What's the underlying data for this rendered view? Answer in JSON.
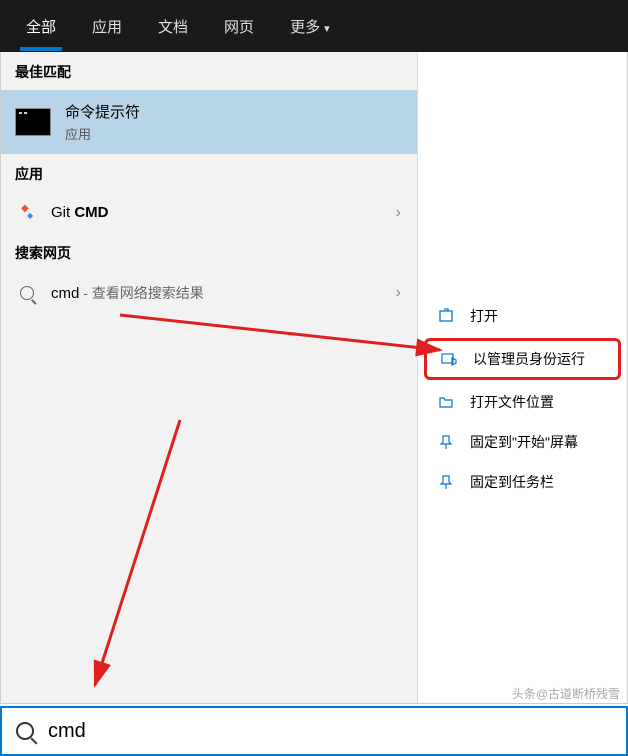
{
  "tabs": {
    "all": "全部",
    "apps": "应用",
    "docs": "文档",
    "web": "网页",
    "more": "更多"
  },
  "sections": {
    "best_match": "最佳匹配",
    "apps": "应用",
    "search_web": "搜索网页"
  },
  "best_match_item": {
    "title": "命令提示符",
    "subtitle": "应用"
  },
  "app_item": {
    "prefix": "Git ",
    "bold": "CMD"
  },
  "web_item": {
    "term": "cmd",
    "suffix": " - 查看网络搜索结果"
  },
  "actions": {
    "open": "打开",
    "run_admin": "以管理员身份运行",
    "open_location": "打开文件位置",
    "pin_start": "固定到\"开始\"屏幕",
    "pin_taskbar": "固定到任务栏"
  },
  "search": {
    "value": "cmd"
  },
  "watermark": "头条@古道断桥残雪"
}
